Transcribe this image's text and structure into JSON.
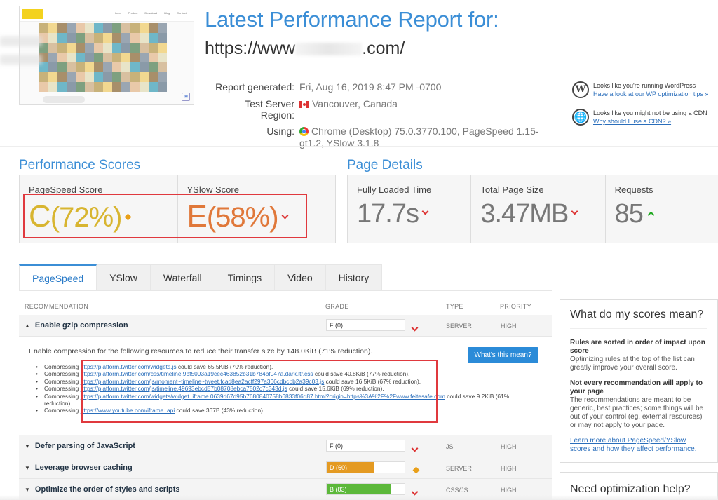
{
  "header": {
    "title": "Latest Performance Report for:",
    "url_prefix": "https://www",
    "url_suffix": ".com/"
  },
  "meta": {
    "report_label": "Report generated:",
    "report_value": "Fri, Aug 16, 2019 8:47 PM -0700",
    "region_label": "Test Server Region:",
    "region_value": "Vancouver, Canada",
    "using_label": "Using:",
    "using_value": "Chrome (Desktop) 75.0.3770.100, PageSpeed 1.15-gt1.2, YSlow 3.1.8"
  },
  "notes": {
    "wp_text": "Looks like you're running WordPress",
    "wp_link": "Have a look at our WP optimization tips »",
    "cdn_text": "Looks like you might not be using a CDN",
    "cdn_link": "Why should I use a CDN? »"
  },
  "thumbnail_nav": [
    "Home",
    "Product",
    "Download",
    "Blog",
    "Contact"
  ],
  "scores": {
    "section_title": "Performance Scores",
    "pagespeed_label": "PageSpeed Score",
    "pagespeed_grade": "C",
    "pagespeed_pct": "(72%)",
    "yslow_label": "YSlow Score",
    "yslow_grade": "E",
    "yslow_pct": "(58%)"
  },
  "details": {
    "section_title": "Page Details",
    "loaded_label": "Fully Loaded Time",
    "loaded_value": "17.7s",
    "size_label": "Total Page Size",
    "size_value": "3.47MB",
    "requests_label": "Requests",
    "requests_value": "85"
  },
  "tabs": [
    "PageSpeed",
    "YSlow",
    "Waterfall",
    "Timings",
    "Video",
    "History"
  ],
  "table": {
    "col_rec": "RECOMMENDATION",
    "col_grade": "GRADE",
    "col_type": "TYPE",
    "col_priority": "PRIORITY",
    "rows": [
      {
        "name": "Enable gzip compression",
        "grade": "F (0)",
        "grade_pct": 0,
        "type": "SERVER",
        "priority": "HIGH"
      },
      {
        "name": "Defer parsing of JavaScript",
        "grade": "F (0)",
        "grade_pct": 0,
        "type": "JS",
        "priority": "HIGH"
      },
      {
        "name": "Leverage browser caching",
        "grade": "D (60)",
        "grade_pct": 60,
        "type": "SERVER",
        "priority": "HIGH"
      },
      {
        "name": "Optimize the order of styles and scripts",
        "grade": "B (83)",
        "grade_pct": 83,
        "type": "CSS/JS",
        "priority": "HIGH"
      }
    ]
  },
  "expanded": {
    "intro": "Enable compression for the following resources to reduce their transfer size by 148.0KiB (71% reduction).",
    "button": "What's this mean?",
    "items": [
      {
        "pre": "Compressing ",
        "link": "https://platform.twitter.com/widgets.js",
        "post": " could save 65.5KiB (70% reduction)."
      },
      {
        "pre": "Compressing ",
        "link": "https://platform.twitter.com/css/timeline.9bf5093a19cec463852b31b784bf047a.dark.ltr.css",
        "post": " could save 40.8KiB (77% reduction)."
      },
      {
        "pre": "Compressing ",
        "link": "https://platform.twitter.com/js/moment~timeline~tweet.fcad8ea2acff297a366cdbcbb2a39c03.js",
        "post": " could save 16.5KiB (67% reduction)."
      },
      {
        "pre": "Compressing ",
        "link": "https://platform.twitter.com/js/timeline.49693ebcd57b08708ebca7502c7c343d.js",
        "post": " could save 15.6KiB (69% reduction)."
      },
      {
        "pre": "Compressing ",
        "link": "https://platform.twitter.com/widgets/widget_iframe.0639d67d95b7680840758b6833f06d87.html?origin=https%3A%2F%2Fwww.feitesafe.com",
        "post": " could save 9.2KiB (61% reduction)."
      },
      {
        "pre": "Compressing ",
        "link": "https://www.youtube.com/iframe_api",
        "post": " could save 367B (43% reduction)."
      }
    ]
  },
  "panel": {
    "title": "What do my scores mean?",
    "h1": "Rules are sorted in order of impact upon score",
    "t1": "Optimizing rules at the top of the list can greatly improve your overall score.",
    "h2": "Not every recommendation will apply to your page",
    "t2": "The recommendations are meant to be generic, best practices; some things will be out of your control (eg. external resources) or may not apply to your page.",
    "link": "Learn more about PageSpeed/YSlow scores and how they affect performance."
  },
  "panel2": {
    "title": "Need optimization help?"
  },
  "colors": {
    "accent": "#3b8ed6",
    "grade_f": "#ffffff",
    "grade_d": "#e49a22",
    "grade_b": "#5cb83a",
    "highlight_frame": "#e0393e"
  }
}
